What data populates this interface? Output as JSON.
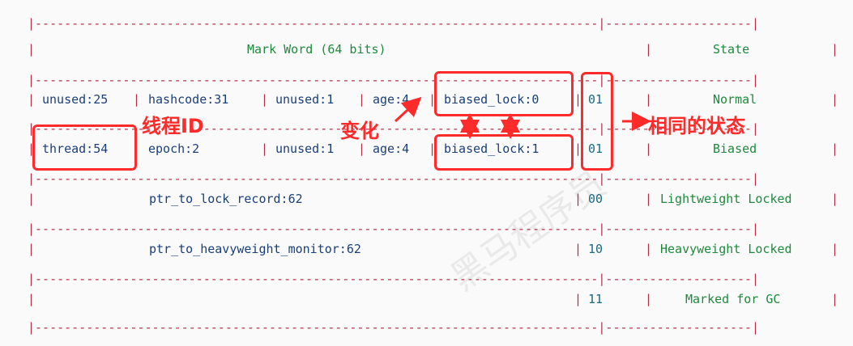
{
  "header": {
    "mark_word": "Mark Word (64 bits)",
    "state": "State"
  },
  "rows": [
    {
      "segments": [
        "unused:25",
        "hashcode:31",
        "unused:1",
        "age:4",
        "biased_lock:0"
      ],
      "bits": "01",
      "state": "Normal"
    },
    {
      "segments": [
        "thread:54",
        "epoch:2",
        "unused:1",
        "age:4",
        "biased_lock:1"
      ],
      "bits": "01",
      "state": "Biased"
    },
    {
      "segments": [
        "ptr_to_lock_record:62"
      ],
      "bits": "00",
      "state": "Lightweight Locked"
    },
    {
      "segments": [
        "ptr_to_heavyweight_monitor:62"
      ],
      "bits": "10",
      "state": "Heavyweight Locked"
    },
    {
      "segments": [
        ""
      ],
      "bits": "11",
      "state": "Marked for GC"
    }
  ],
  "annotations": {
    "thread_id": "线程ID",
    "change": "变化",
    "same_state": "相同的状态"
  },
  "watermark": "黑马程序员",
  "colors": {
    "annotation_red": "#ff2a2a",
    "state_green": "#1e8a3c",
    "field_blue": "#1b3f7a",
    "dash_red": "#b0304a"
  }
}
